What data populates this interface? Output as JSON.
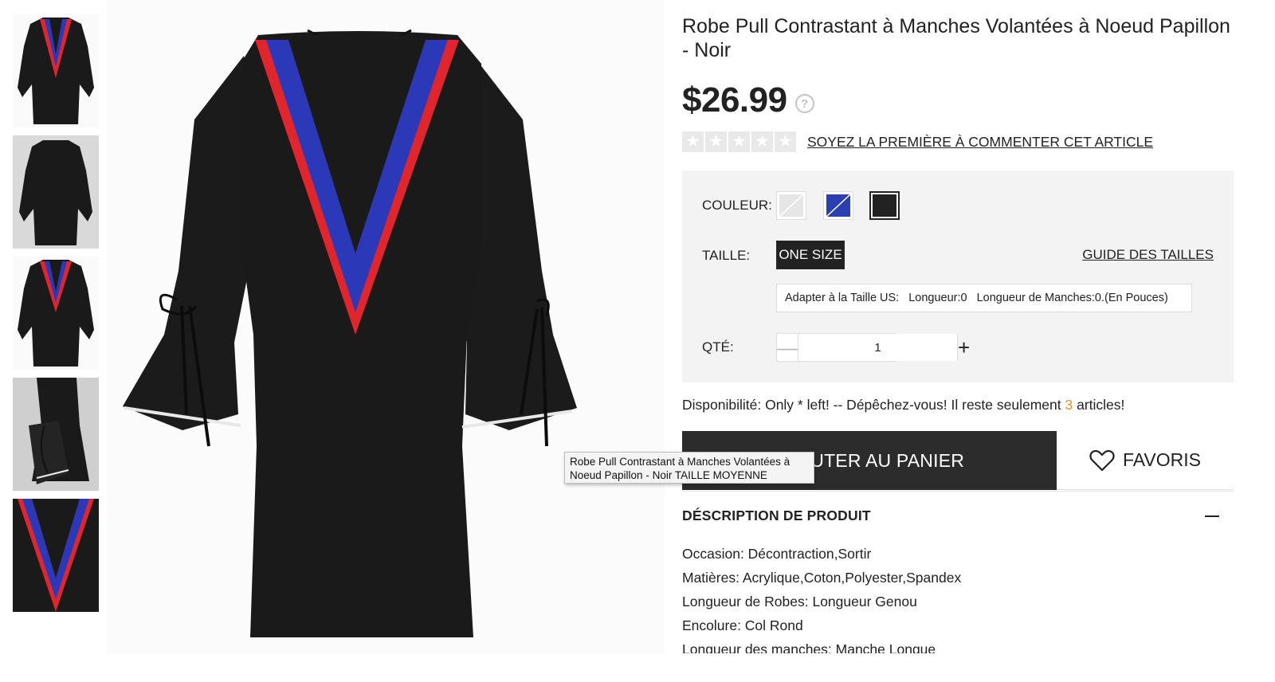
{
  "thumbnails": [
    {
      "alt": "front view"
    },
    {
      "alt": "back view"
    },
    {
      "alt": "front view alt"
    },
    {
      "alt": "side detail"
    },
    {
      "alt": "stripe detail"
    }
  ],
  "tooltip": {
    "line1": "Robe Pull Contrastant à Manches Volantées à",
    "line2": "Noeud Papillon - Noir TAILLE MOYENNE"
  },
  "product": {
    "title": "Robe Pull Contrastant à Manches Volantées à Noeud Papillon - Noir",
    "price": "$26.99",
    "help_icon": "?",
    "review_link": "SOYEZ LA PREMIÈRE À COMMENTER CET ARTICLE",
    "stars_filled": 0,
    "stars_total": 5
  },
  "options": {
    "color_label": "COULEUR:",
    "colors": [
      {
        "name": "light grey",
        "hex": "#e6e6e6"
      },
      {
        "name": "blue",
        "hex": "#2c3fb0"
      },
      {
        "name": "black",
        "hex": "#222222"
      }
    ],
    "selected_color": "black",
    "size_label": "TAILLE:",
    "size_value": "ONE SIZE",
    "size_guide": "GUIDE DES TAILLES",
    "size_info": {
      "fit": "Adapter à la Taille US:",
      "length": "Longueur:0",
      "sleeve": "Longueur de Manches:0.(En Pouces)"
    },
    "qty_label": "QTÉ:",
    "qty_value": "1",
    "qty_minus": "—",
    "qty_plus": "+"
  },
  "availability": {
    "prefix": "Disponibilité: Only * left! -- Dépêchez-vous! Il reste seulement ",
    "count": "3",
    "suffix": " articles!"
  },
  "actions": {
    "cart_label": "AJOUTER AU PANIER",
    "favorites_label": "FAVORIS"
  },
  "description": {
    "title": "DÉSCRIPTION DE PRODUIT",
    "lines": [
      "Occasion: Décontraction,Sortir",
      "Matières: Acrylique,Coton,Polyester,Spandex",
      "Longueur de Robes: Longueur Genou",
      "Encolure: Col Rond",
      "Longueur des manches: Manche Longue"
    ]
  },
  "colors": {
    "dress_black": "#1a1a1a",
    "stripe_blue": "#2b39b8",
    "stripe_red": "#e0262c",
    "accent_orange": "#e0902c"
  }
}
